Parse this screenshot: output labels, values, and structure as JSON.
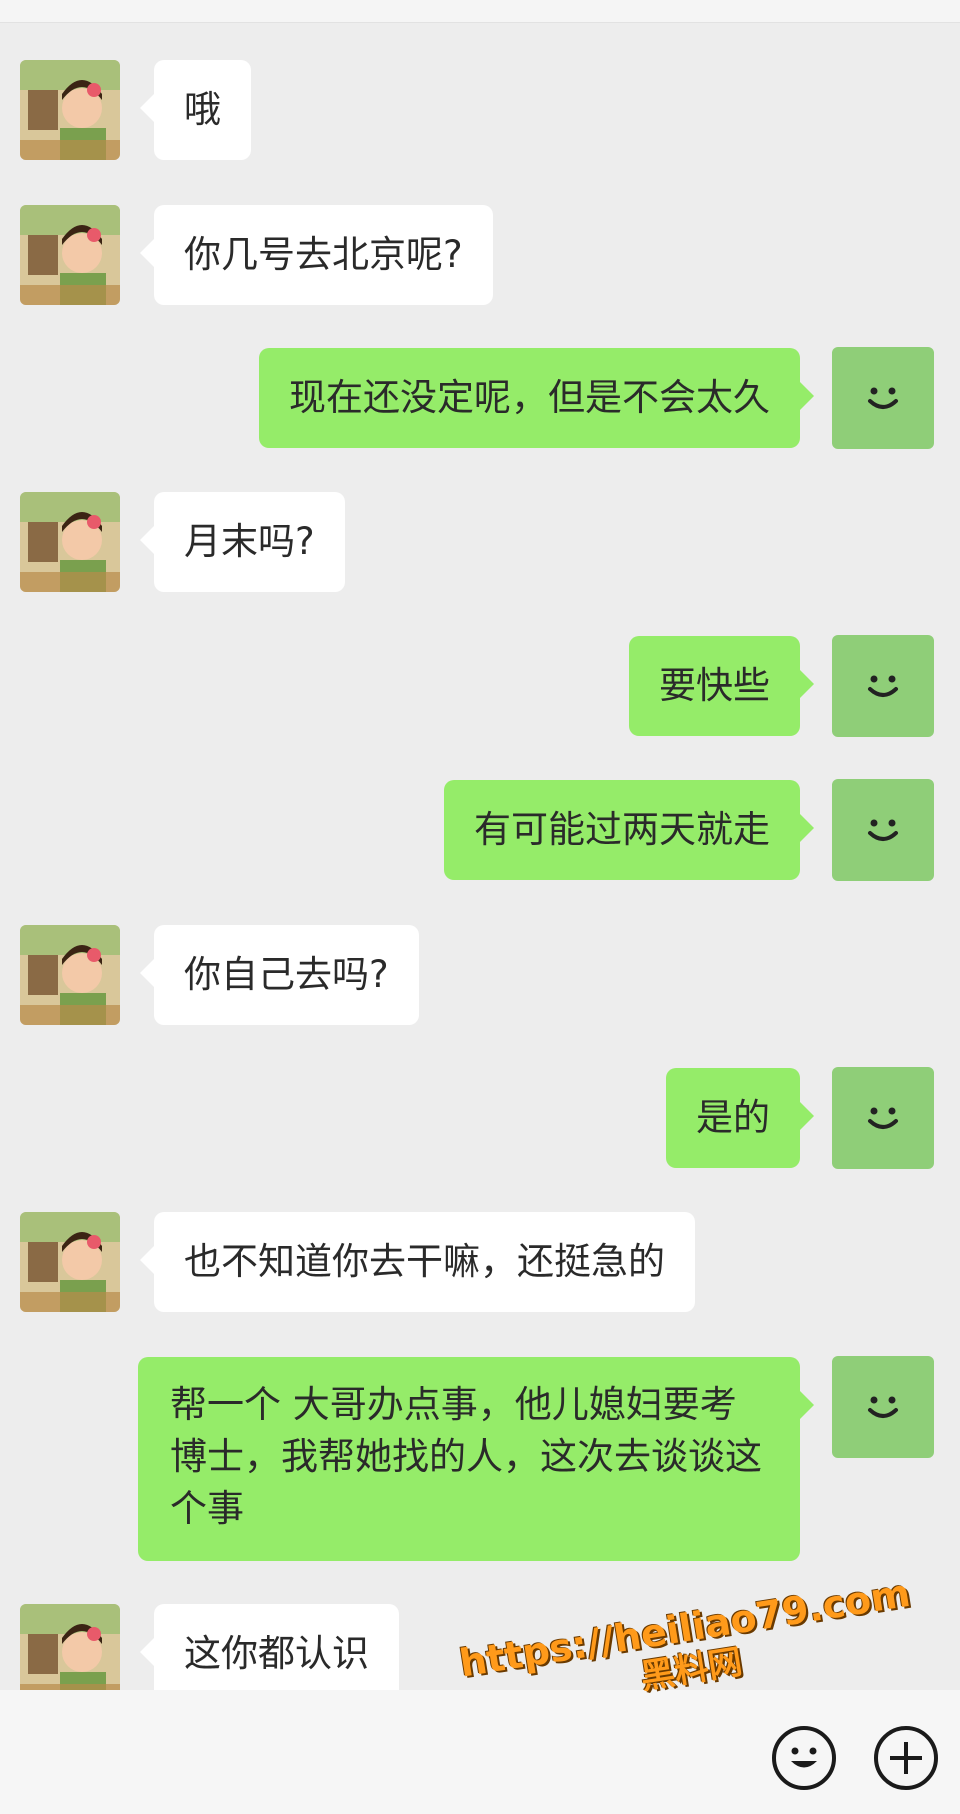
{
  "colors": {
    "background": "#ededed",
    "incoming_bubble": "#ffffff",
    "outgoing_bubble": "#95ec69",
    "self_avatar": "#8fce78"
  },
  "icons": {
    "contact_avatar": "cartoon-girl-avatar",
    "self_avatar": "smiley-face",
    "emoji": "emoji-icon",
    "plus": "plus-icon"
  },
  "messages": [
    {
      "side": "left",
      "text": "哦"
    },
    {
      "side": "left",
      "text": "你几号去北京呢?"
    },
    {
      "side": "right",
      "text": "现在还没定呢，但是不会太久"
    },
    {
      "side": "left",
      "text": "月末吗?"
    },
    {
      "side": "right",
      "text": "要快些"
    },
    {
      "side": "right",
      "text": "有可能过两天就走"
    },
    {
      "side": "left",
      "text": "你自己去吗?"
    },
    {
      "side": "right",
      "text": "是的"
    },
    {
      "side": "left",
      "text": "也不知道你去干嘛，还挺急的"
    },
    {
      "side": "right",
      "text": "帮一个 大哥办点事，他儿媳妇要考博士，我帮她找的人，这次去谈谈这个事"
    },
    {
      "side": "left",
      "text": "这你都认识"
    }
  ],
  "watermark": {
    "url": "https://heiliao79.com",
    "label": "黑料网"
  }
}
